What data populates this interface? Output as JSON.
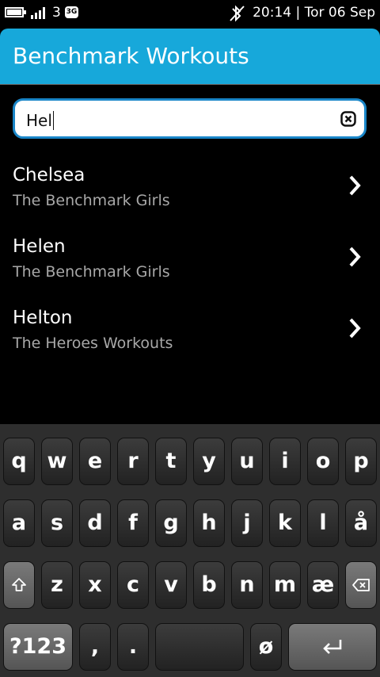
{
  "status": {
    "carrier": "3",
    "network_badge": "3G",
    "datetime": "20:14 | Tor 06 Sep"
  },
  "header": {
    "title": "Benchmark Workouts"
  },
  "search": {
    "value": "Hel"
  },
  "results": [
    {
      "name": "Chelsea",
      "category": "The Benchmark Girls"
    },
    {
      "name": "Helen",
      "category": "The Benchmark Girls"
    },
    {
      "name": "Helton",
      "category": "The Heroes Workouts"
    }
  ],
  "keyboard": {
    "row1": [
      "q",
      "w",
      "e",
      "r",
      "t",
      "y",
      "u",
      "i",
      "o",
      "p"
    ],
    "row2": [
      "a",
      "s",
      "d",
      "f",
      "g",
      "h",
      "j",
      "k",
      "l",
      "å"
    ],
    "row3": [
      "z",
      "x",
      "c",
      "v",
      "b",
      "n",
      "m",
      "æ"
    ],
    "row4": {
      "symbols": "?123",
      "comma": ",",
      "period": ".",
      "o_slash": "ø"
    },
    "icons": {
      "shift": "shift-icon",
      "backspace": "backspace-icon",
      "enter": "enter-icon"
    }
  },
  "colors": {
    "accent": "#17a8da",
    "search_border": "#1a86c8",
    "subtext": "#a8a8a8"
  }
}
